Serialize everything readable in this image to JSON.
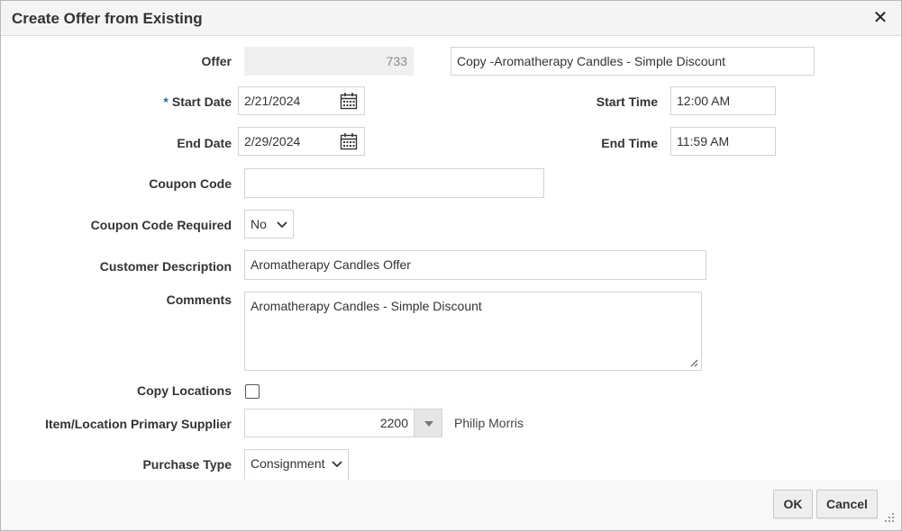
{
  "dialog": {
    "title": "Create Offer from Existing"
  },
  "form": {
    "offer": {
      "label": "Offer",
      "id": "733",
      "name": "Copy -Aromatherapy Candles - Simple Discount"
    },
    "start_date": {
      "label": "Start Date",
      "required_marker": "*",
      "value": "2/21/2024"
    },
    "start_time": {
      "label": "Start Time",
      "value": "12:00 AM"
    },
    "end_date": {
      "label": "End Date",
      "value": "2/29/2024"
    },
    "end_time": {
      "label": "End Time",
      "value": "11:59 AM"
    },
    "coupon_code": {
      "label": "Coupon Code",
      "value": ""
    },
    "coupon_code_required": {
      "label": "Coupon Code Required",
      "value": "No"
    },
    "customer_description": {
      "label": "Customer Description",
      "value": "Aromatherapy Candles Offer"
    },
    "comments": {
      "label": "Comments",
      "value": "Aromatherapy Candles - Simple Discount"
    },
    "copy_locations": {
      "label": "Copy Locations",
      "checked": false
    },
    "primary_supplier": {
      "label": "Item/Location Primary Supplier",
      "value": "2200",
      "name": "Philip Morris"
    },
    "purchase_type": {
      "label": "Purchase Type",
      "value": "Consignment"
    }
  },
  "footer": {
    "ok_label": "OK",
    "cancel_label": "Cancel"
  },
  "icons": {
    "close": "close-icon",
    "calendar": "calendar-icon",
    "chevron": "chevron-down-icon",
    "lov": "triangle-down-icon",
    "resize": "resize-grip-icon"
  }
}
